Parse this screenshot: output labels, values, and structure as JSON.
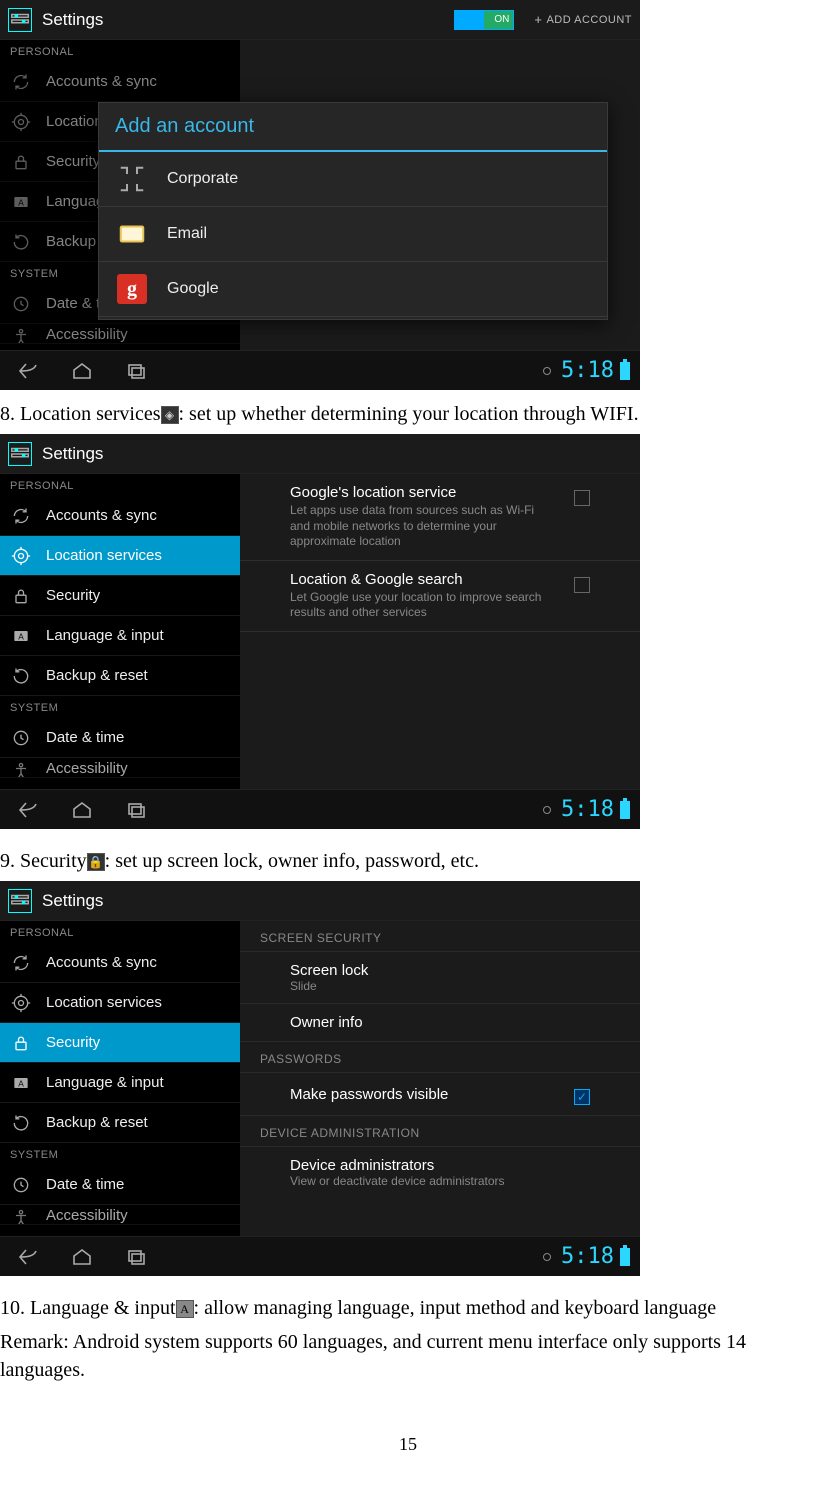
{
  "shot1": {
    "title": "Settings",
    "toggle": "ON",
    "add_account": "ADD ACCOUNT",
    "sections": {
      "personal": "PERSONAL",
      "system": "SYSTEM"
    },
    "sidebar": {
      "accounts": "Accounts & sync",
      "location": "Location services",
      "security": "Security",
      "language": "Language & input",
      "backup": "Backup & reset",
      "datetime": "Date & time",
      "access": "Accessibility"
    },
    "dialog": {
      "title": "Add an account",
      "items": {
        "corporate": "Corporate",
        "email": "Email",
        "google": "Google"
      }
    },
    "clock": "5:18"
  },
  "doc_line8": "8. Location services",
  "doc_line8b": ": set up whether determining your location through WIFI.",
  "shot2": {
    "title": "Settings",
    "selected": "Location services",
    "opts": {
      "gls_title": "Google's location service",
      "gls_sub": "Let apps use data from sources such as Wi-Fi and mobile networks to determine your approximate location",
      "lgs_title": "Location & Google search",
      "lgs_sub": "Let Google use your location to improve search results and other services"
    },
    "clock": "5:18"
  },
  "doc_line9": "9. Security",
  "doc_line9b": ": set up screen lock, owner info, password, etc.",
  "shot3": {
    "title": "Settings",
    "selected": "Security",
    "cats": {
      "screen": "SCREEN SECURITY",
      "passwords": "PASSWORDS",
      "device": "DEVICE ADMINISTRATION"
    },
    "rows": {
      "lock_title": "Screen lock",
      "lock_sub": "Slide",
      "owner": "Owner info",
      "make_vis": "Make passwords visible",
      "admin_title": "Device administrators",
      "admin_sub": "View or deactivate device administrators"
    },
    "clock": "5:18"
  },
  "doc_line10": "10. Language & input",
  "doc_line10b": ": allow managing language, input method and keyboard language",
  "doc_remark": "Remark: Android system supports 60 languages, and current menu interface only supports 14 languages.",
  "page": "15"
}
